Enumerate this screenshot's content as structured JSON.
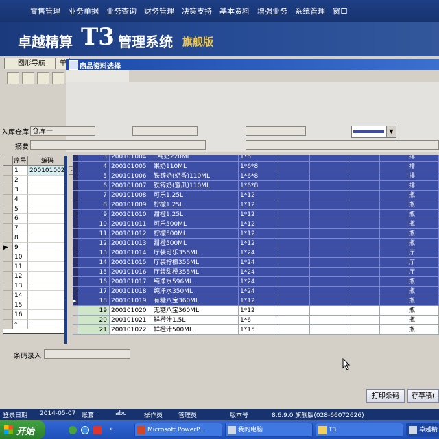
{
  "menu": [
    "零售管理",
    "业务单据",
    "业务查询",
    "财务管理",
    "决策支持",
    "基本资料",
    "增强业务",
    "系统管理",
    "窗口"
  ],
  "banner": {
    "title_part1": "卓越精算",
    "title_t3": "T3",
    "title_part2": "管理系统",
    "edition": "旗舰版"
  },
  "tabs": [
    "图形导航",
    "单"
  ],
  "subwindow_title": "商品资料选择",
  "form": {
    "warehouse_label": "入库仓库",
    "warehouse_value": "仓库一",
    "summary_label": "摘要",
    "barcode_label": "条码录入"
  },
  "left_grid": {
    "headers": [
      "序号",
      "编码"
    ],
    "rows": [
      {
        "n": "1",
        "code": "200101002"
      },
      {
        "n": "2",
        "code": ""
      },
      {
        "n": "3",
        "code": ""
      },
      {
        "n": "4",
        "code": ""
      },
      {
        "n": "5",
        "code": ""
      },
      {
        "n": "6",
        "code": ""
      },
      {
        "n": "7",
        "code": ""
      },
      {
        "n": "8",
        "code": ""
      },
      {
        "n": "9",
        "code": ""
      },
      {
        "n": "10",
        "code": ""
      },
      {
        "n": "11",
        "code": ""
      },
      {
        "n": "12",
        "code": ""
      },
      {
        "n": "13",
        "code": ""
      },
      {
        "n": "14",
        "code": ""
      },
      {
        "n": "15",
        "code": ""
      },
      {
        "n": "16",
        "code": ""
      },
      {
        "n": "*",
        "code": ""
      }
    ],
    "ellipsis": "..."
  },
  "product_grid": {
    "rows": [
      {
        "n": "3",
        "code": "200101004",
        "name": "..纯奶220ML",
        "spec": "1*6",
        "unit": "排",
        "selected": true
      },
      {
        "n": "4",
        "code": "200101005",
        "name": "果奶110ML",
        "spec": "1*6*8",
        "unit": "排",
        "selected": true
      },
      {
        "n": "5",
        "code": "200101006",
        "name": "铁锌奶(奶香)110ML",
        "spec": "1*6*8",
        "unit": "排",
        "selected": true
      },
      {
        "n": "6",
        "code": "200101007",
        "name": "铁锌奶(蜜瓜)110ML",
        "spec": "1*6*8",
        "unit": "排",
        "selected": true
      },
      {
        "n": "7",
        "code": "200101008",
        "name": "可乐1.25L",
        "spec": "1*12",
        "unit": "瓶",
        "selected": true
      },
      {
        "n": "8",
        "code": "200101009",
        "name": "柠檬1.25L",
        "spec": "1*12",
        "unit": "瓶",
        "selected": true
      },
      {
        "n": "9",
        "code": "200101010",
        "name": "甜橙1.25L",
        "spec": "1*12",
        "unit": "瓶",
        "selected": true
      },
      {
        "n": "10",
        "code": "200101011",
        "name": "可乐500ML",
        "spec": "1*12",
        "unit": "瓶",
        "selected": true
      },
      {
        "n": "11",
        "code": "200101012",
        "name": "柠檬500ML",
        "spec": "1*12",
        "unit": "瓶",
        "selected": true
      },
      {
        "n": "12",
        "code": "200101013",
        "name": "甜橙500ML",
        "spec": "1*12",
        "unit": "瓶",
        "selected": true
      },
      {
        "n": "13",
        "code": "200101014",
        "name": "厅装可乐355ML",
        "spec": "1*24",
        "unit": "厅",
        "selected": true
      },
      {
        "n": "14",
        "code": "200101015",
        "name": "厅装柠檬355ML",
        "spec": "1*24",
        "unit": "厅",
        "selected": true
      },
      {
        "n": "15",
        "code": "200101016",
        "name": "厅装甜橙355ML",
        "spec": "1*24",
        "unit": "厅",
        "selected": true
      },
      {
        "n": "16",
        "code": "200101017",
        "name": "纯净水596ML",
        "spec": "1*24",
        "unit": "瓶",
        "selected": true
      },
      {
        "n": "17",
        "code": "200101018",
        "name": "纯净水350ML",
        "spec": "1*24",
        "unit": "瓶",
        "selected": true
      },
      {
        "n": "18",
        "code": "200101019",
        "name": "有糖八宝360ML",
        "spec": "1*12",
        "unit": "瓶",
        "selected": true
      },
      {
        "n": "19",
        "code": "200101020",
        "name": "无糖八宝360ML",
        "spec": "1*12",
        "unit": "瓶",
        "selected": false
      },
      {
        "n": "20",
        "code": "200101021",
        "name": "鲜橙汁1.5L",
        "spec": "1*6",
        "unit": "瓶",
        "selected": false
      },
      {
        "n": "21",
        "code": "200101022",
        "name": "鲜橙汁500ML",
        "spec": "1*15",
        "unit": "瓶",
        "selected": false
      }
    ]
  },
  "buttons": {
    "print_barcode": "打印条码",
    "save_draft": "存草稿("
  },
  "status": {
    "login_date_label": "登录日期",
    "login_date": "2014-05-07",
    "account_label": "账套",
    "account": "abc",
    "operator_label": "操作员",
    "operator": "管理员",
    "version_label": "版本号",
    "version": "8.6.9.0 旗舰版(028-66072626)"
  },
  "taskbar": {
    "start": "开始",
    "tasks": [
      "Microsoft PowerP...",
      "我的电脑",
      "T3",
      "卓越精"
    ]
  },
  "colors": {
    "selected_row": "#3c4ea6",
    "menu_bg": "#1e3f86",
    "row_number_bg": "#cfe7c8"
  }
}
